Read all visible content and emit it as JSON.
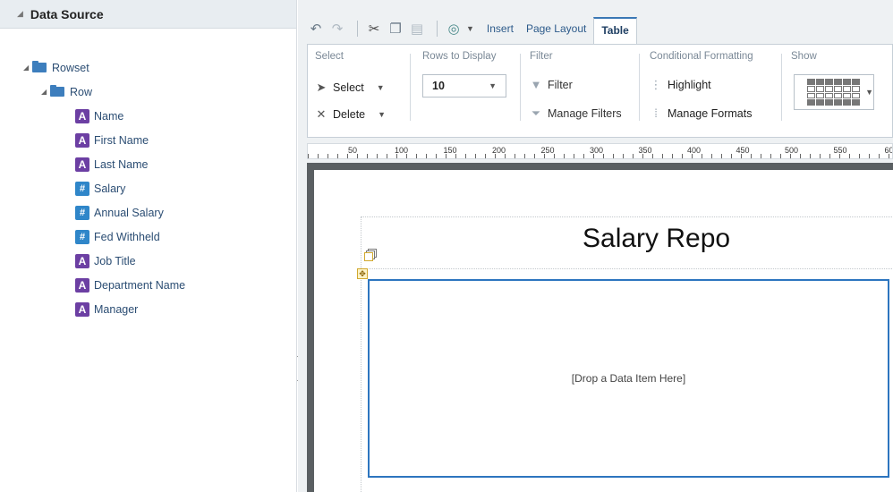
{
  "data_source": {
    "title": "Data Source",
    "rowset_label": "Rowset",
    "row_label": "Row",
    "fields": [
      {
        "label": "Name",
        "type": "text",
        "glyph": "A",
        "icon": "text-field-icon"
      },
      {
        "label": "First Name",
        "type": "text",
        "glyph": "A",
        "icon": "text-field-icon"
      },
      {
        "label": "Last Name",
        "type": "text",
        "glyph": "A",
        "icon": "text-field-icon"
      },
      {
        "label": "Salary",
        "type": "number",
        "glyph": "#",
        "icon": "numeric-field-icon"
      },
      {
        "label": "Annual Salary",
        "type": "number",
        "glyph": "#",
        "icon": "numeric-field-icon"
      },
      {
        "label": "Fed Withheld",
        "type": "number",
        "glyph": "#",
        "icon": "numeric-field-icon"
      },
      {
        "label": "Job Title",
        "type": "text",
        "glyph": "A",
        "icon": "text-field-icon"
      },
      {
        "label": "Department Name",
        "type": "text",
        "glyph": "A",
        "icon": "text-field-icon"
      },
      {
        "label": "Manager",
        "type": "text",
        "glyph": "A",
        "icon": "text-field-icon"
      }
    ]
  },
  "toolbar": {
    "icons": [
      "undo-icon",
      "redo-icon",
      "cut-icon",
      "copy-icon",
      "paste-icon",
      "data-model-icon"
    ],
    "tabs": [
      "Insert",
      "Page Layout",
      "Table"
    ],
    "active_tab": "Table"
  },
  "ribbon": {
    "select_group": {
      "title": "Select",
      "select_label": "Select",
      "delete_label": "Delete"
    },
    "rows_group": {
      "title": "Rows to Display",
      "value": "10"
    },
    "filter_group": {
      "title": "Filter",
      "filter_label": "Filter",
      "manage_label": "Manage Filters"
    },
    "cf_group": {
      "title": "Conditional Formatting",
      "highlight_label": "Highlight",
      "manage_label": "Manage Formats"
    },
    "show_group": {
      "title": "Show"
    }
  },
  "ruler": {
    "marks": [
      "50",
      "100",
      "150",
      "200",
      "250",
      "300",
      "350",
      "400",
      "450",
      "500",
      "550",
      "60"
    ]
  },
  "canvas": {
    "report_title": "Salary Repo",
    "drop_placeholder": "[Drop a Data Item Here]"
  },
  "colors": {
    "accent": "#2d75bf",
    "text_badge": "#6c3fa3",
    "number_badge": "#2f86c9"
  }
}
